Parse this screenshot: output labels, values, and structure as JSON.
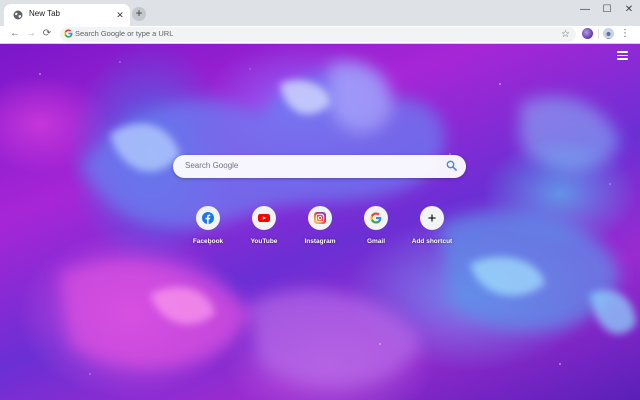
{
  "tab": {
    "title": "New Tab",
    "close_glyph": "✕",
    "new_tab_glyph": "+"
  },
  "window_controls": {
    "minimize": "—",
    "maximize": "☐",
    "close": "✕"
  },
  "toolbar": {
    "back_glyph": "←",
    "forward_glyph": "→",
    "reload_glyph": "⟳",
    "omnibox_placeholder": "Search Google or type a URL",
    "star_glyph": "☆",
    "menu_glyph": "⋮"
  },
  "ntp": {
    "search_placeholder": "Search Google",
    "shortcuts": [
      {
        "label": "Facebook",
        "icon": "facebook-icon",
        "color": "#1877f2"
      },
      {
        "label": "YouTube",
        "icon": "youtube-icon",
        "color": "#ff0000"
      },
      {
        "label": "Instagram",
        "icon": "instagram-icon",
        "color": "#c13584"
      },
      {
        "label": "Gmail",
        "icon": "google-icon",
        "color": "#4285f4"
      },
      {
        "label": "Add shortcut",
        "icon": "plus-icon",
        "color": "#202124"
      }
    ]
  },
  "colors": {
    "tabstrip": "#dee1e6",
    "omnibox": "#f1f3f4",
    "search_accent": "#4285f4"
  }
}
